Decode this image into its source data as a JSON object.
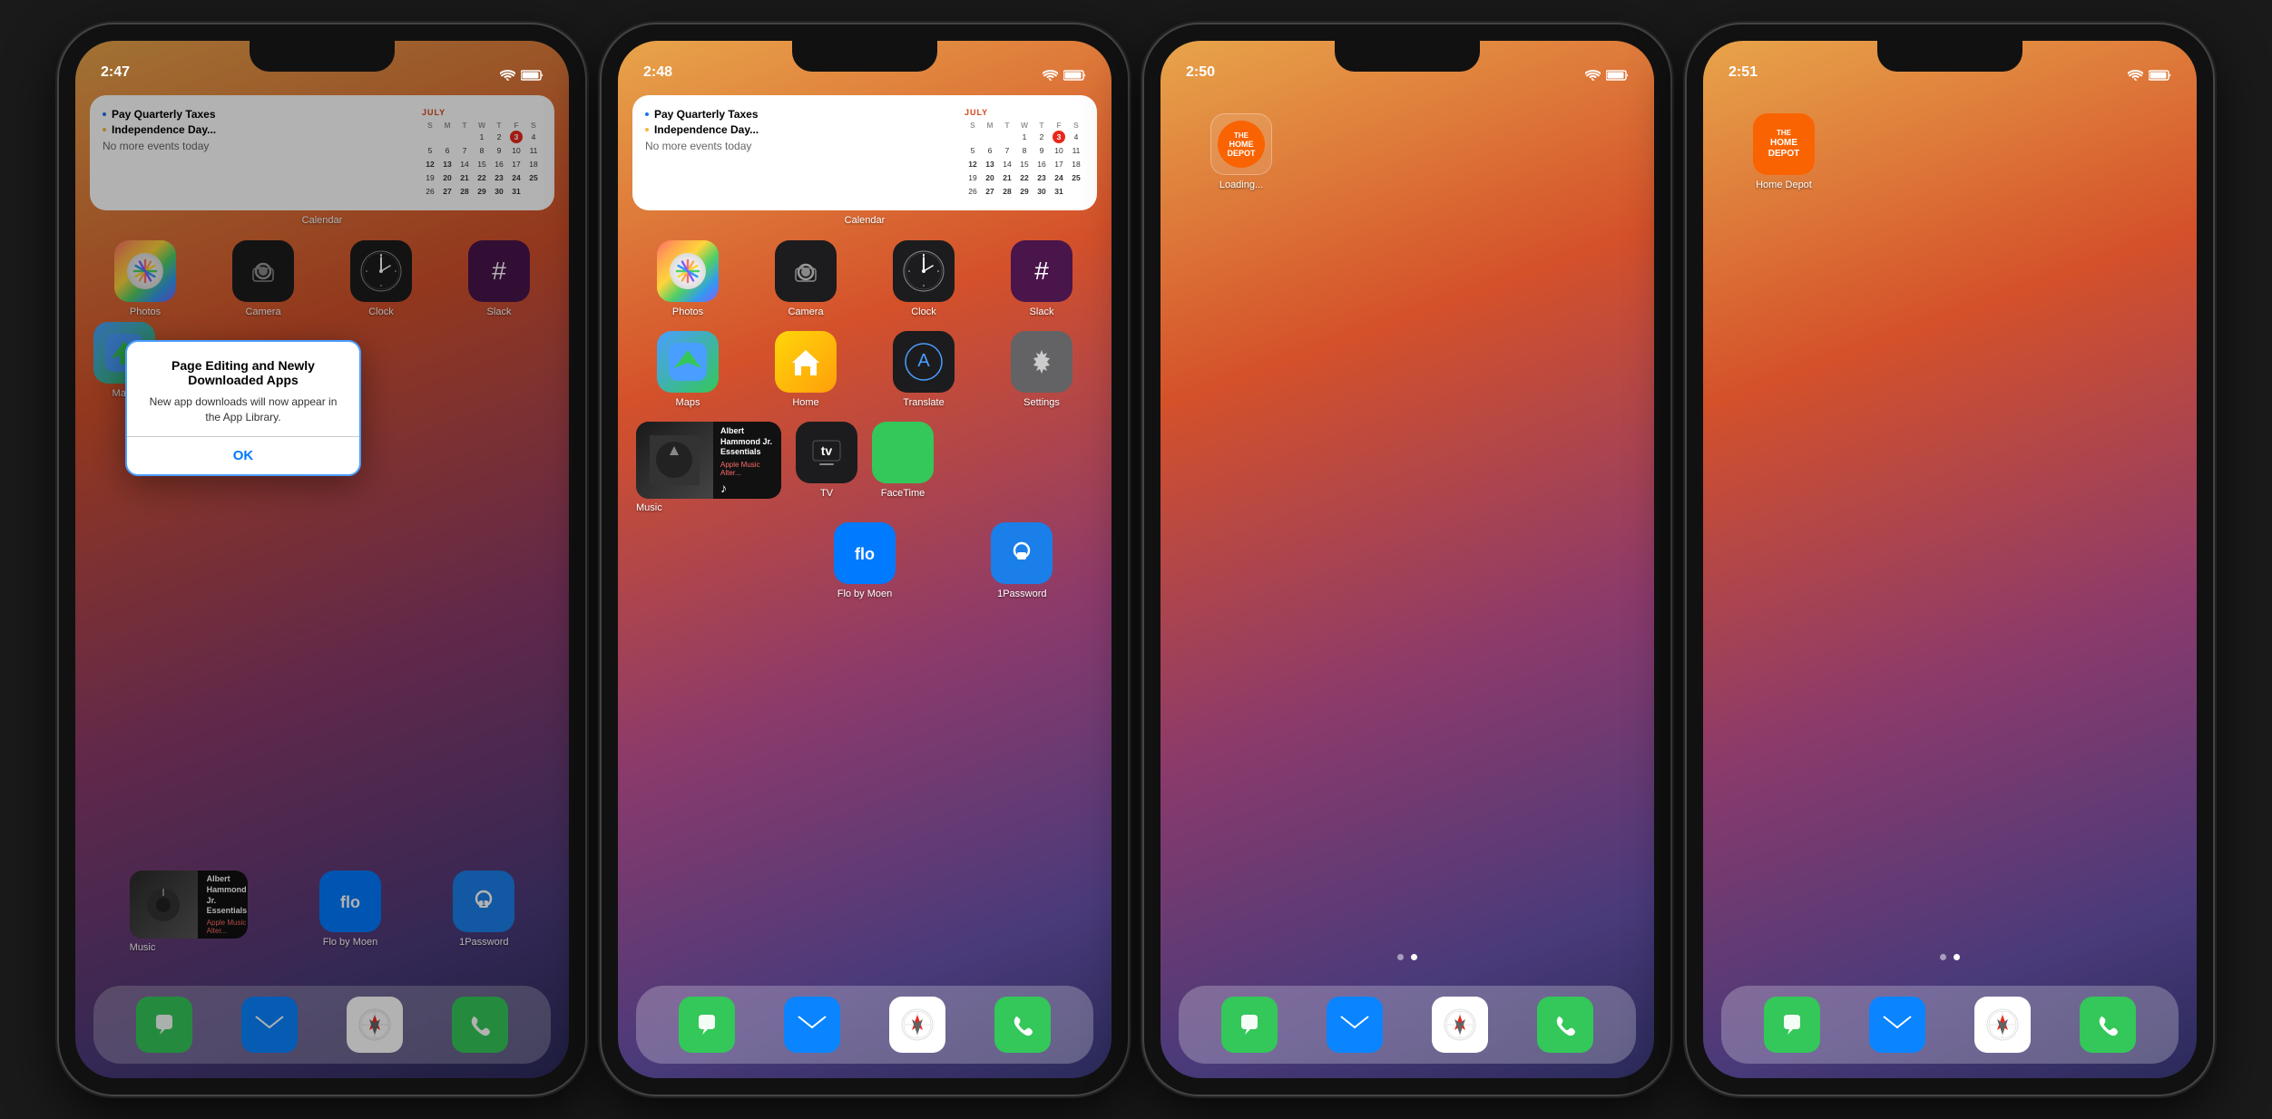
{
  "phones": [
    {
      "id": "phone1",
      "time": "2:47",
      "wallpaper": "warm",
      "widget": {
        "type": "calendar",
        "label": "Calendar",
        "events": [
          {
            "color": "blue",
            "text": "Pay Quarterly Taxes"
          },
          {
            "color": "yellow",
            "text": "Independence Day..."
          }
        ],
        "no_events": "No more events today",
        "month": "JULY",
        "days_header": [
          "S",
          "M",
          "T",
          "W",
          "T",
          "F",
          "S"
        ],
        "weeks": [
          [
            "",
            "",
            "",
            "1",
            "2",
            "3",
            "4"
          ],
          [
            "5",
            "6",
            "7",
            "8",
            "9",
            "10",
            "11"
          ],
          [
            "12",
            "13",
            "14",
            "15",
            "16",
            "17",
            "18"
          ],
          [
            "19",
            "20",
            "21",
            "22",
            "23",
            "24",
            "25"
          ],
          [
            "26",
            "27",
            "28",
            "29",
            "30",
            "31",
            ""
          ]
        ],
        "today": "3"
      },
      "apps_row1": [
        {
          "label": "Photos",
          "icon": "photos"
        },
        {
          "label": "Camera",
          "icon": "camera"
        },
        {
          "label": "Clock",
          "icon": "clock"
        },
        {
          "label": "Slack",
          "icon": "slack"
        }
      ],
      "apps_row2_partial": [
        {
          "label": "Maps",
          "icon": "maps"
        }
      ],
      "alert": {
        "title": "Page Editing and Newly Downloaded Apps",
        "message": "New app downloads will now appear in the App Library.",
        "ok_label": "OK"
      },
      "music_widget": {
        "title": "Albert Hammond Jr. Essentials",
        "subtitle": "Apple Music Alter..."
      },
      "dock_apps_row2": [
        {
          "label": "Music",
          "icon": "music"
        },
        {
          "label": "Flo by Moen",
          "icon": "flo"
        },
        {
          "label": "1Password",
          "icon": "1password"
        }
      ],
      "dock": [
        {
          "label": "Messages",
          "icon": "messages"
        },
        {
          "label": "Mail",
          "icon": "mail"
        },
        {
          "label": "Safari",
          "icon": "safari"
        },
        {
          "label": "Phone",
          "icon": "phone"
        }
      ]
    },
    {
      "id": "phone2",
      "time": "2:48",
      "wallpaper": "warm",
      "widget": {
        "type": "calendar",
        "label": "Calendar",
        "events": [
          {
            "color": "blue",
            "text": "Pay Quarterly Taxes"
          },
          {
            "color": "yellow",
            "text": "Independence Day..."
          }
        ],
        "no_events": "No more events today",
        "month": "JULY",
        "days_header": [
          "S",
          "M",
          "T",
          "W",
          "T",
          "F",
          "S"
        ],
        "weeks": [
          [
            "",
            "",
            "",
            "1",
            "2",
            "3",
            "4"
          ],
          [
            "5",
            "6",
            "7",
            "8",
            "9",
            "10",
            "11"
          ],
          [
            "12",
            "13",
            "14",
            "15",
            "16",
            "17",
            "18"
          ],
          [
            "19",
            "20",
            "21",
            "22",
            "23",
            "24",
            "25"
          ],
          [
            "26",
            "27",
            "28",
            "29",
            "30",
            "31",
            ""
          ]
        ],
        "today": "3"
      },
      "apps_row1": [
        {
          "label": "Photos",
          "icon": "photos"
        },
        {
          "label": "Camera",
          "icon": "camera"
        },
        {
          "label": "Clock",
          "icon": "clock"
        },
        {
          "label": "Slack",
          "icon": "slack"
        }
      ],
      "apps_row2": [
        {
          "label": "Maps",
          "icon": "maps"
        },
        {
          "label": "Home",
          "icon": "home"
        },
        {
          "label": "Translate",
          "icon": "translate"
        },
        {
          "label": "Settings",
          "icon": "settings"
        }
      ],
      "apps_row3": [
        {
          "label": "Music",
          "icon": "music_widget"
        },
        {
          "label": "TV",
          "icon": "tv"
        },
        {
          "label": "FaceTime",
          "icon": "facetime"
        },
        {
          "label": "",
          "icon": ""
        }
      ],
      "music_widget": {
        "title": "Albert Hammond Jr. Essentials",
        "subtitle": "Apple Music Alter..."
      },
      "dock_row": [
        {
          "label": "Music",
          "icon": "music"
        },
        {
          "label": "Flo by Moen",
          "icon": "flo"
        },
        {
          "label": "1Password",
          "icon": "1password"
        }
      ],
      "dock": [
        {
          "label": "Messages",
          "icon": "messages"
        },
        {
          "label": "Mail",
          "icon": "mail"
        },
        {
          "label": "Safari",
          "icon": "safari"
        },
        {
          "label": "Phone",
          "icon": "phone"
        }
      ]
    },
    {
      "id": "phone3",
      "time": "2:50",
      "wallpaper": "warm",
      "loading_app": {
        "label": "Loading...",
        "icon": "homedepot"
      },
      "page_dots": [
        false,
        true
      ],
      "dock": [
        {
          "label": "Messages",
          "icon": "messages"
        },
        {
          "label": "Mail",
          "icon": "mail"
        },
        {
          "label": "Safari",
          "icon": "safari"
        },
        {
          "label": "Phone",
          "icon": "phone"
        }
      ]
    },
    {
      "id": "phone4",
      "time": "2:51",
      "wallpaper": "warm",
      "installed_app": {
        "label": "Home Depot",
        "icon": "homedepot"
      },
      "page_dots": [
        false,
        true
      ],
      "dock": [
        {
          "label": "Messages",
          "icon": "messages"
        },
        {
          "label": "Mail",
          "icon": "mail"
        },
        {
          "label": "Safari",
          "icon": "safari"
        },
        {
          "label": "Phone",
          "icon": "phone"
        }
      ]
    }
  ],
  "icons": {
    "wifi": "📶",
    "battery": "🔋"
  },
  "colors": {
    "accent_blue": "#007aff",
    "accent_red": "#e8291a",
    "green": "#34c759",
    "orange": "#f96302"
  }
}
